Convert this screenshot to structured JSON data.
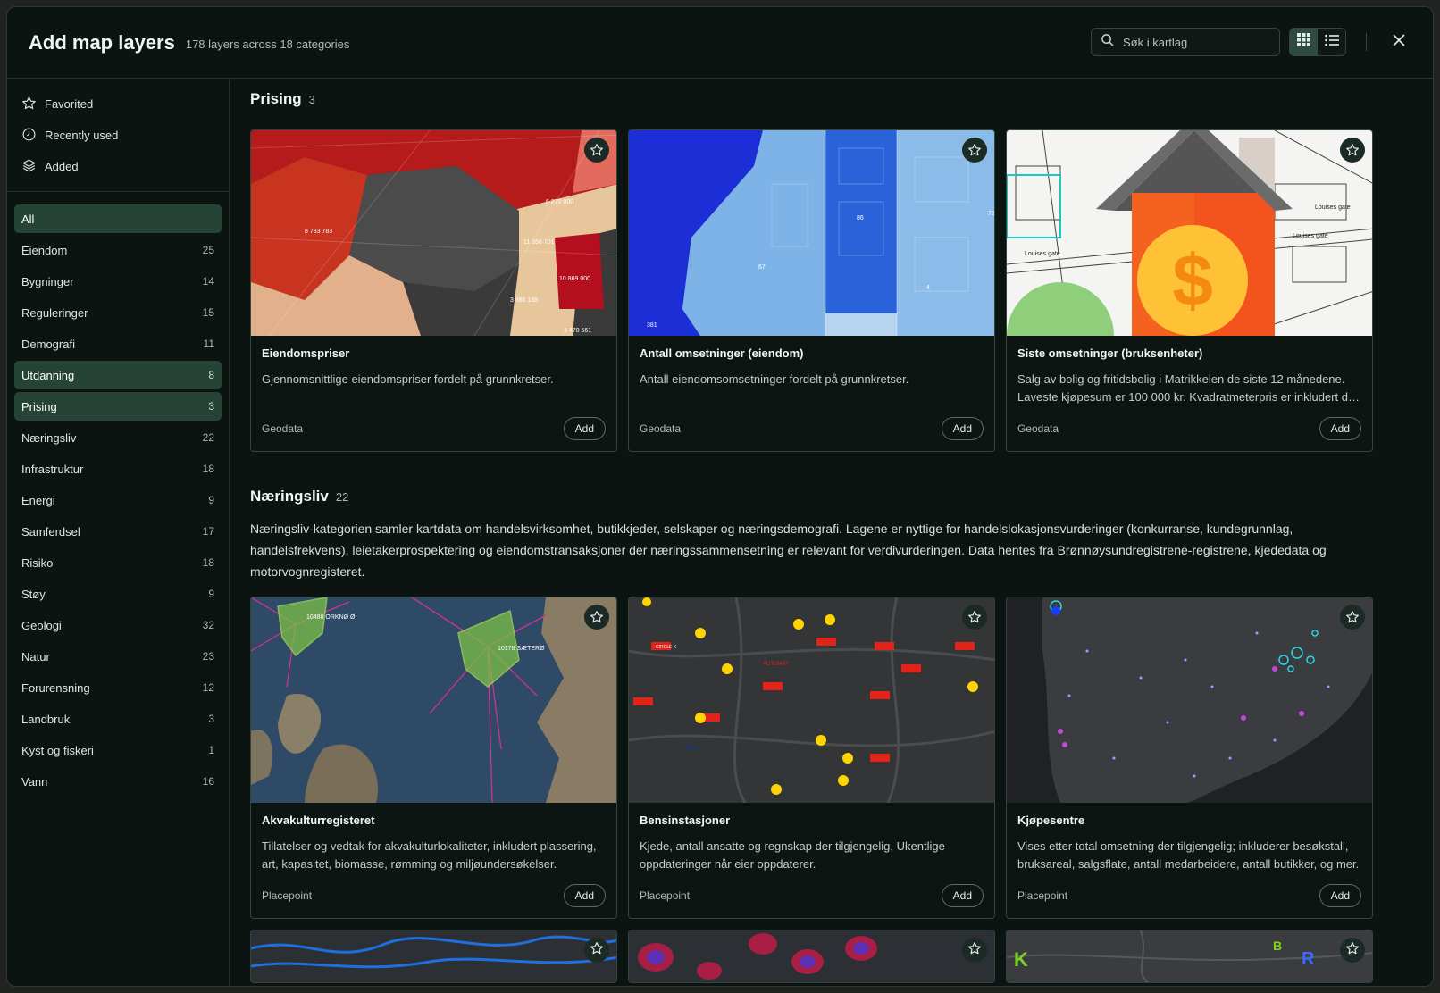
{
  "header": {
    "title": "Add map layers",
    "subtitle": "178 layers across 18 categories",
    "search_placeholder": "Søk i kartlag"
  },
  "quick_links": [
    {
      "label": "Favorited",
      "icon": "star-icon"
    },
    {
      "label": "Recently used",
      "icon": "clock-icon"
    },
    {
      "label": "Added",
      "icon": "layers-icon"
    }
  ],
  "categories": [
    {
      "label": "All",
      "count": ""
    },
    {
      "label": "Eiendom",
      "count": "25"
    },
    {
      "label": "Bygninger",
      "count": "14"
    },
    {
      "label": "Reguleringer",
      "count": "15"
    },
    {
      "label": "Demografi",
      "count": "11"
    },
    {
      "label": "Utdanning",
      "count": "8"
    },
    {
      "label": "Prising",
      "count": "3"
    },
    {
      "label": "Næringsliv",
      "count": "22"
    },
    {
      "label": "Infrastruktur",
      "count": "18"
    },
    {
      "label": "Energi",
      "count": "9"
    },
    {
      "label": "Samferdsel",
      "count": "17"
    },
    {
      "label": "Risiko",
      "count": "18"
    },
    {
      "label": "Støy",
      "count": "9"
    },
    {
      "label": "Geologi",
      "count": "32"
    },
    {
      "label": "Natur",
      "count": "23"
    },
    {
      "label": "Forurensning",
      "count": "12"
    },
    {
      "label": "Landbruk",
      "count": "3"
    },
    {
      "label": "Kyst og fiskeri",
      "count": "1"
    },
    {
      "label": "Vann",
      "count": "16"
    }
  ],
  "sections": [
    {
      "title": "Prising",
      "count": "3",
      "description": "",
      "cards": [
        {
          "title": "Eiendomspriser",
          "description": "Gjennomsnittlige eiendomspriser fordelt på grunnkretser.",
          "source": "Geodata",
          "add": "Add"
        },
        {
          "title": "Antall omsetninger (eiendom)",
          "description": "Antall eiendomsomsetninger fordelt på grunnkretser.",
          "source": "Geodata",
          "add": "Add"
        },
        {
          "title": "Siste omsetninger (bruksenheter)",
          "description": "Salg av bolig og fritidsbolig i Matrikkelen de siste 12 månedene. Laveste kjøpesum er 100 000 kr. Kvadratmeterpris er inkludert der areal er tilgjengelig.",
          "source": "Geodata",
          "add": "Add"
        }
      ]
    },
    {
      "title": "Næringsliv",
      "count": "22",
      "description": "Næringsliv-kategorien samler kartdata om handelsvirksomhet, butikkjeder, selskaper og næringsdemografi. Lagene er nyttige for handelslokasjonsvurderinger (konkurranse, kundegrunnlag, handelsfrekvens), leietakerprospektering og eiendomstransaksjoner der næringssammensetning er relevant for verdivurderingen. Data hentes fra Brønnøysundregistrene-registrene, kjededata og motorvognregisteret.",
      "cards": [
        {
          "title": "Akvakulturregisteret",
          "description": "Tillatelser og vedtak for akvakulturlokaliteter, inkludert plassering, art, kapasitet, biomasse, rømming og miljøundersøkelser.",
          "source": "Placepoint",
          "add": "Add"
        },
        {
          "title": "Bensinstasjoner",
          "description": "Kjede, antall ansatte og regnskap der tilgjengelig. Ukentlige oppdateringer når eier oppdaterer.",
          "source": "Placepoint",
          "add": "Add"
        },
        {
          "title": "Kjøpesentre",
          "description": "Vises etter total omsetning der tilgjengelig; inkluderer besøkstall, bruksareal, salgsflate, antall medarbeidere, antall butikker, og mer.",
          "source": "Placepoint",
          "add": "Add"
        }
      ]
    }
  ],
  "map_labels": {
    "prices": [
      "8 783 783",
      "11 358 701",
      "10 869 000",
      "3 886 188",
      "3 470 561",
      "6 270 000"
    ],
    "transactions": [
      "86",
      "78",
      "381",
      "67",
      "4"
    ],
    "streets": [
      "Louises gate",
      "Louises gate",
      "Louises gate"
    ],
    "aqua": [
      "10480 ORKNØ Ø",
      "10178 SÆTERØ"
    ],
    "stations": [
      "CIRCLE K",
      "AUTOMAT",
      "Esso",
      "Uno-X"
    ]
  },
  "colors": {
    "accent": "#254436",
    "background": "#0c1411",
    "border": "#34453d"
  }
}
